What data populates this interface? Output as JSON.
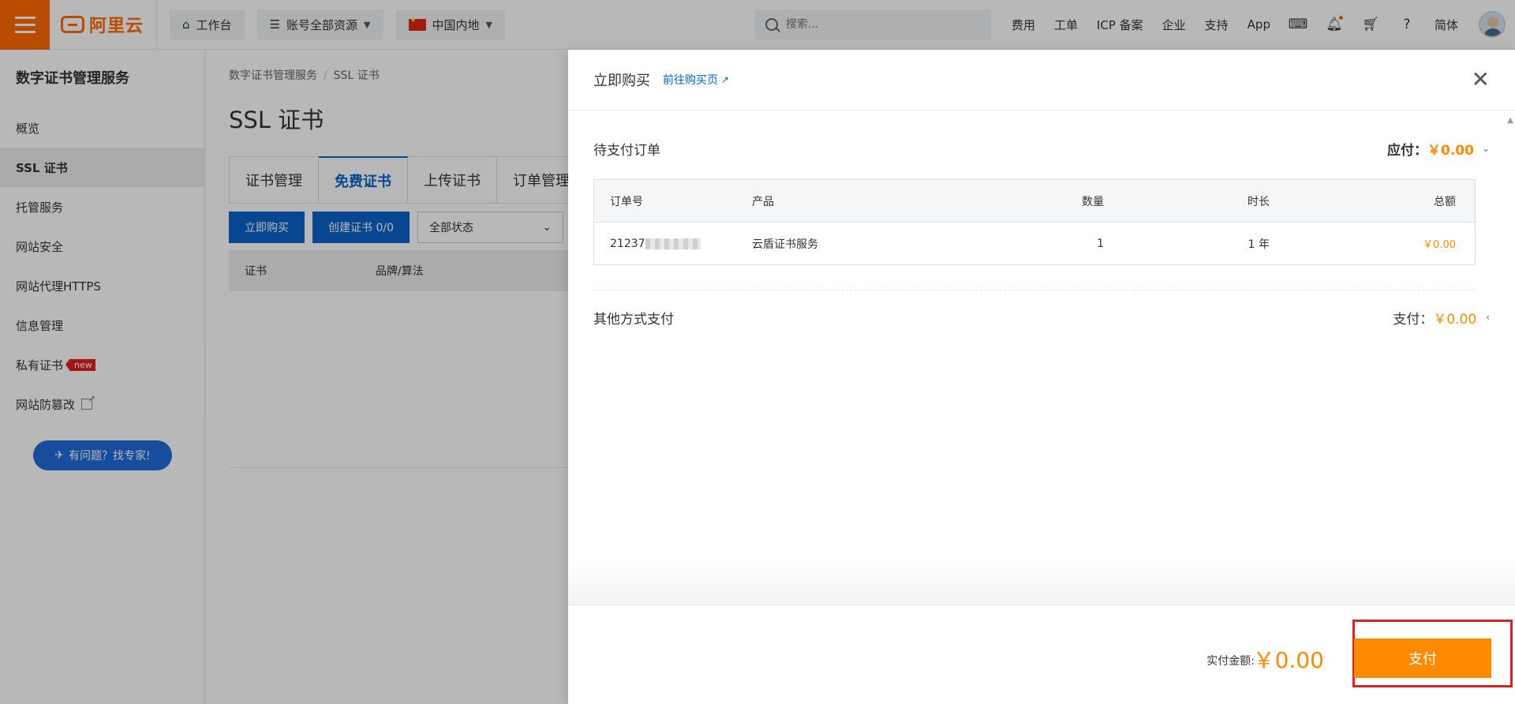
{
  "topbar": {
    "logo_text": "阿里云",
    "workbench": "工作台",
    "resources": "账号全部资源",
    "region": "中国内地",
    "search_placeholder": "搜索...",
    "links": [
      "费用",
      "工单",
      "ICP 备案",
      "企业",
      "支持",
      "App"
    ],
    "lang": "简体"
  },
  "sidebar": {
    "title": "数字证书管理服务",
    "items": [
      {
        "label": "概览"
      },
      {
        "label": "SSL 证书"
      },
      {
        "label": "托管服务"
      },
      {
        "label": "网站安全"
      },
      {
        "label": "网站代理HTTPS"
      },
      {
        "label": "信息管理"
      },
      {
        "label": "私有证书",
        "badge": "new"
      },
      {
        "label": "网站防篡改"
      }
    ],
    "help": "有问题？找专家!"
  },
  "main": {
    "breadcrumb": [
      "数字证书管理服务",
      "SSL 证书"
    ],
    "title": "SSL 证书",
    "tabs": [
      "证书管理",
      "免费证书",
      "上传证书",
      "订单管理"
    ],
    "buy_button": "立即购买",
    "create_button": "创建证书 0/0",
    "status_select": "全部状态",
    "columns": [
      "证书",
      "品牌/算法"
    ]
  },
  "drawer": {
    "title": "立即购买",
    "link": "前往购买页",
    "pending_title": "待支付订单",
    "payable_label": "应付：",
    "payable_amount": "￥0.00",
    "table_headers": [
      "订单号",
      "产品",
      "数量",
      "时长",
      "总额"
    ],
    "order": {
      "id_prefix": "21237",
      "product": "云盾证书服务",
      "qty": "1",
      "duration": "1 年",
      "total": "￥0.00"
    },
    "other_title": "其他方式支付",
    "other_label": "支付：",
    "other_amount": "￥0.00",
    "actual_label": "实付金额:",
    "actual_amount": "￥0.00",
    "pay_button": "支付"
  },
  "colors": {
    "brand": "#ff6a00",
    "accent_blue": "#0064c8",
    "price": "#ff8a00",
    "highlight": "#e02020"
  }
}
